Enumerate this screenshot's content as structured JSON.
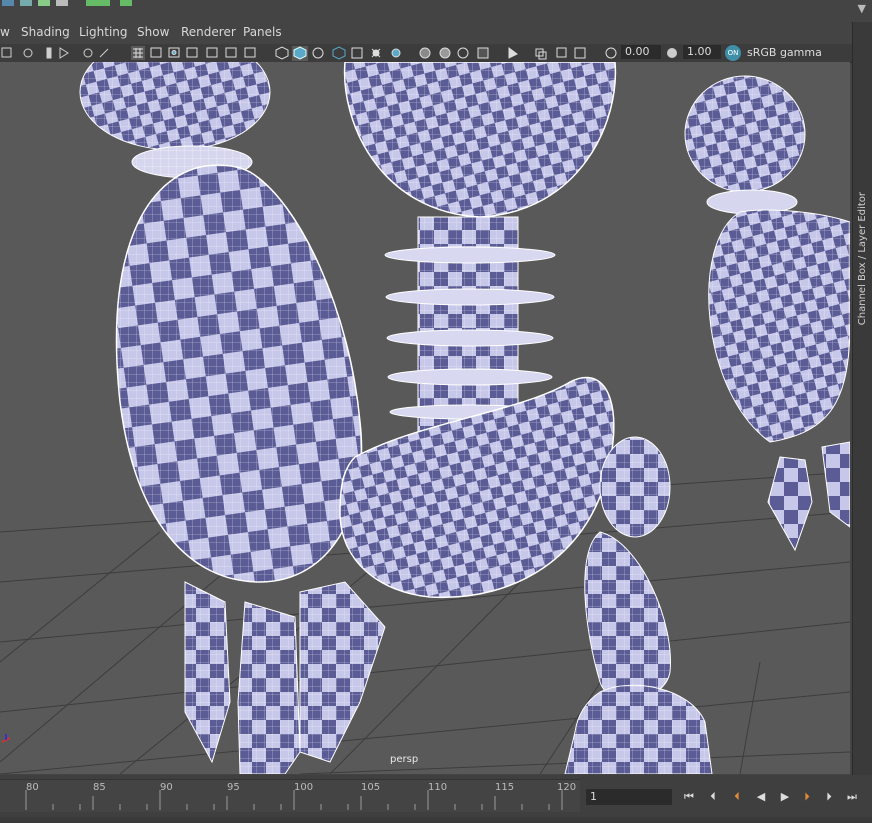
{
  "menubar": {
    "items": [
      {
        "label": "w"
      },
      {
        "label": "Shading"
      },
      {
        "label": "Lighting"
      },
      {
        "label": "Show"
      },
      {
        "label": "Renderer"
      },
      {
        "label": "Panels"
      }
    ]
  },
  "toolbar": {
    "exposure_value": "0.00",
    "gamma_value": "1.00",
    "color_management_toggle": "ON",
    "view_transform": "sRGB gamma"
  },
  "side_panel": {
    "tab_label": "Channel Box / Layer Editor"
  },
  "viewport": {
    "camera_label": "persp"
  },
  "timeline": {
    "ticks": [
      "80",
      "85",
      "90",
      "95",
      "100",
      "105",
      "110",
      "115",
      "120"
    ],
    "current_frame": "1"
  },
  "colors": {
    "viewport_bg": "#595959",
    "mesh_light": "#c7c7ea",
    "mesh_dark": "#5b5b96",
    "wire": "#ffffff",
    "active_icon": "#5aa9c8"
  },
  "icons": {
    "playback": [
      "go-to-start-icon",
      "step-back-key-icon",
      "step-back-frame-icon",
      "play-backwards-icon",
      "play-forwards-icon",
      "step-forward-frame-icon",
      "step-forward-key-icon",
      "go-to-end-icon"
    ]
  }
}
